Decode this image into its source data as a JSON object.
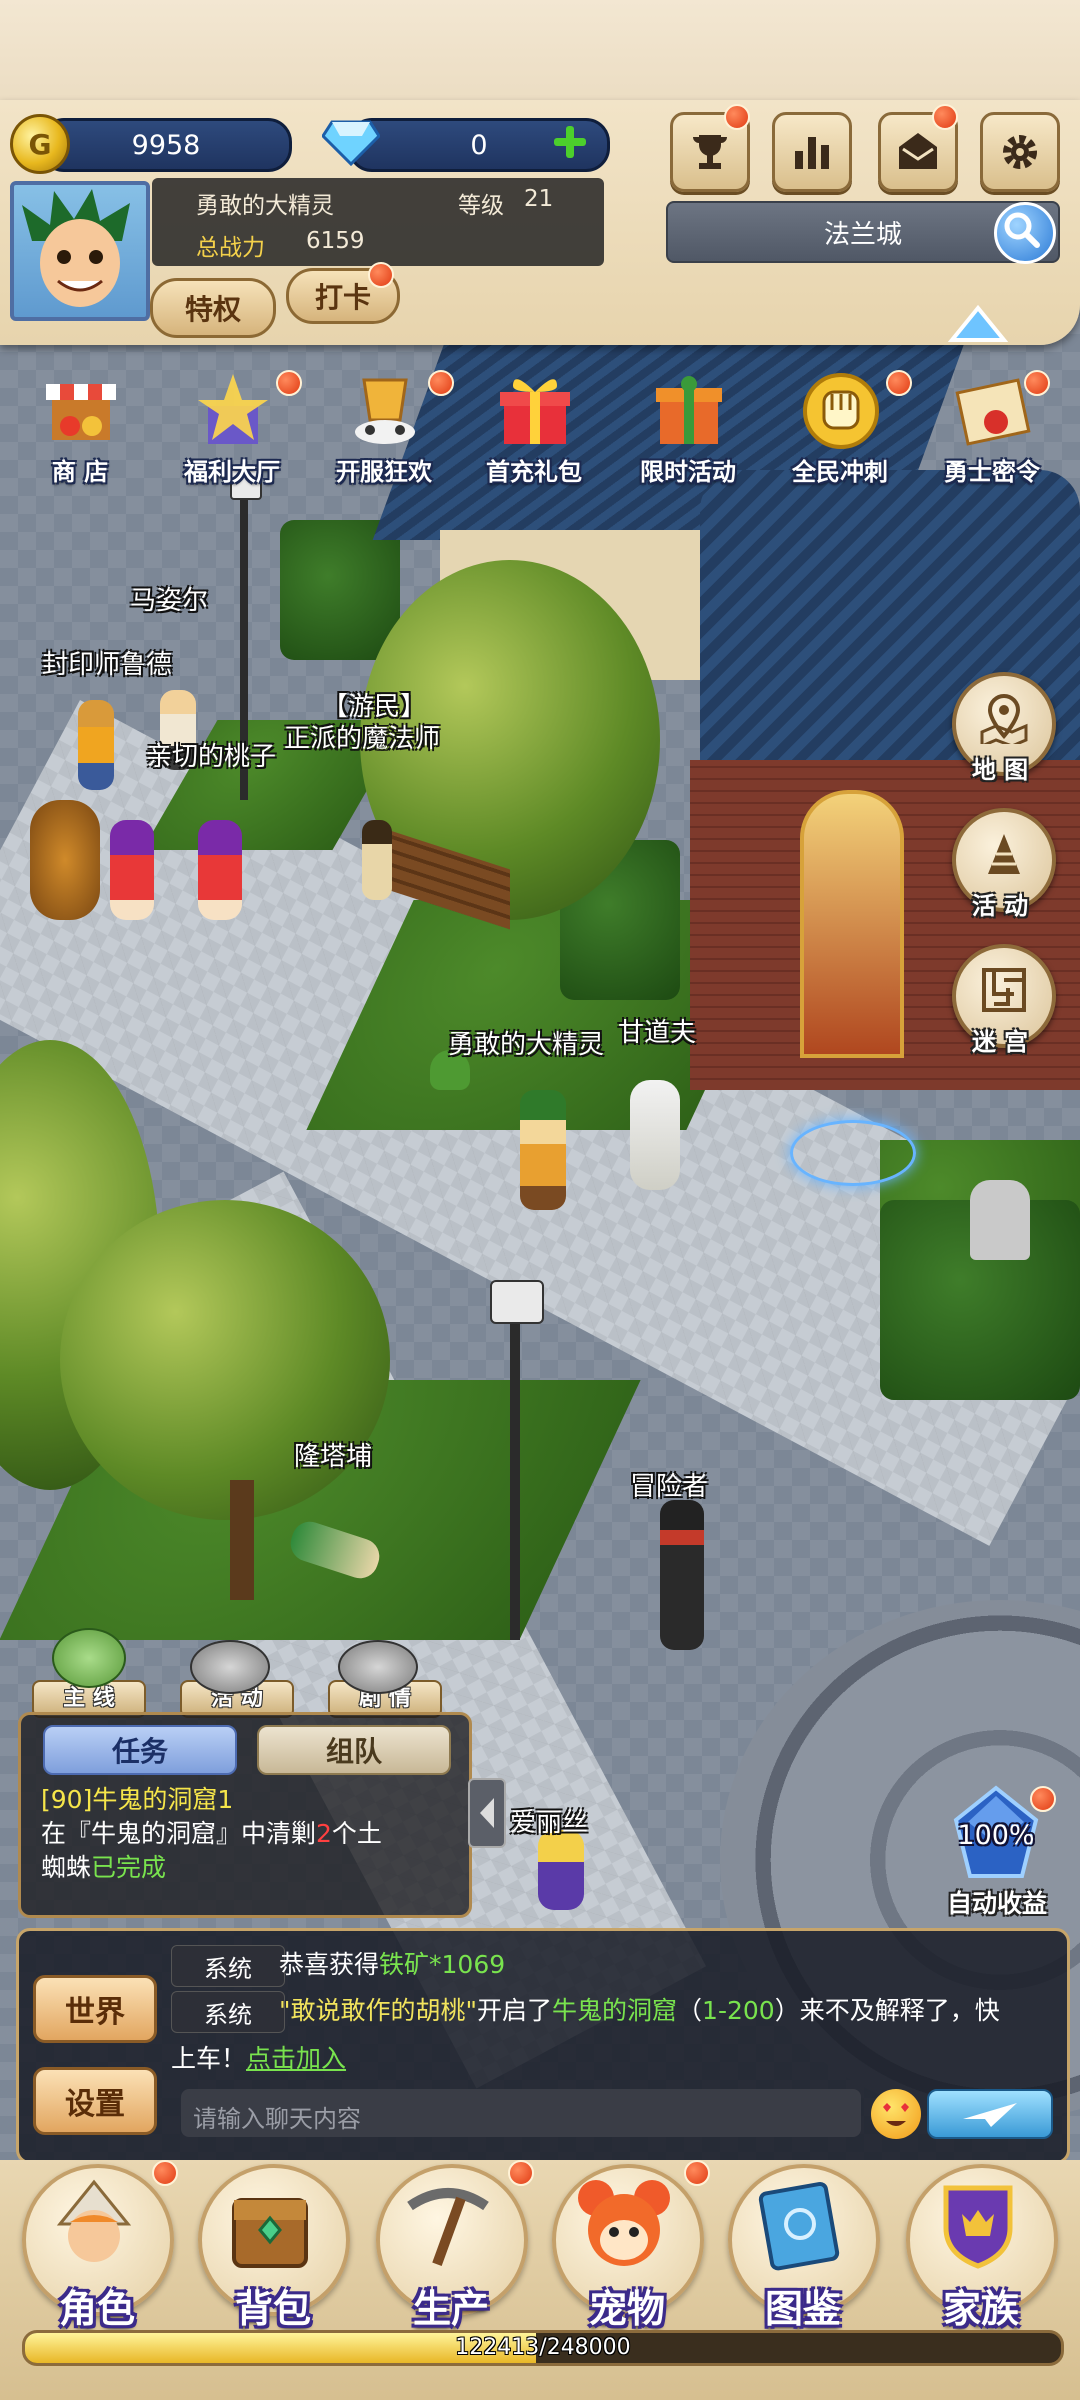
{
  "resources": {
    "gold": "9958",
    "gold_symbol": "G",
    "diamonds": "0"
  },
  "player": {
    "name": "勇敢的大精灵",
    "level_label": "等级",
    "level": "21",
    "power_label": "总战力",
    "power": "6159"
  },
  "buttons": {
    "privilege": "特权",
    "checkin": "打卡"
  },
  "location": "法兰城",
  "top_icons": [
    "trophy-icon",
    "stats-icon",
    "mail-icon",
    "gear-icon"
  ],
  "events": [
    {
      "label": "商 店",
      "icon": "shop-icon",
      "badge": false
    },
    {
      "label": "福利大厅",
      "icon": "welfare-icon",
      "badge": true
    },
    {
      "label": "开服狂欢",
      "icon": "carnival-icon",
      "badge": true
    },
    {
      "label": "首充礼包",
      "icon": "gift-icon",
      "badge": false
    },
    {
      "label": "限时活动",
      "icon": "limited-event-icon",
      "badge": false
    },
    {
      "label": "全民冲刺",
      "icon": "fist-icon",
      "badge": true
    },
    {
      "label": "勇士密令",
      "icon": "letter-icon",
      "badge": true
    }
  ],
  "npcs": [
    {
      "name": "马姿尔"
    },
    {
      "name": "封印师鲁德"
    },
    {
      "name": "亲切的桃子"
    },
    {
      "name": "【游民】"
    },
    {
      "name": "正派的魔法师"
    },
    {
      "name": "勇敢的大精灵"
    },
    {
      "name": "甘道夫"
    },
    {
      "name": "隆塔埔"
    },
    {
      "name": "冒险者"
    },
    {
      "name": "爱丽丝"
    }
  ],
  "side_buttons": [
    {
      "label": "地 图",
      "icon": "map-icon"
    },
    {
      "label": "活 动",
      "icon": "activity-icon"
    },
    {
      "label": "迷 宫",
      "icon": "maze-icon"
    }
  ],
  "auto_income": {
    "percent": "100%",
    "label": "自动收益"
  },
  "quest_tabs_mini": [
    "主 线",
    "活 动",
    "剧 情"
  ],
  "quest": {
    "tab_task": "任务",
    "tab_team": "组队",
    "title": "[90]牛鬼的洞窟1",
    "desc_pre": "在『牛鬼的洞窟』中清剿",
    "count": "2",
    "desc_post": "个土",
    "desc_line2": "蜘蛛",
    "status": "已完成"
  },
  "chat": {
    "world_btn": "世界",
    "settings_btn": "设置",
    "msg1": {
      "tag": "系统",
      "pre": "恭喜获得",
      "item": "铁矿*1069"
    },
    "msg2": {
      "tag": "系统",
      "player": "\"敢说敢作的胡桃\"",
      "mid": "开启了",
      "dungeon": "牛鬼的洞窟",
      "range_open": "（",
      "range": "1-200",
      "range_close": "）",
      "post": "来不及解释了，快",
      "line2": "上车！",
      "link": "点击加入"
    },
    "input_placeholder": "请输入聊天内容"
  },
  "nav": [
    {
      "label": "角色",
      "badge": true
    },
    {
      "label": "背包",
      "badge": false
    },
    {
      "label": "生产",
      "badge": true
    },
    {
      "label": "宠物",
      "badge": true
    },
    {
      "label": "图鉴",
      "badge": false
    },
    {
      "label": "家族",
      "badge": false
    }
  ],
  "xp": {
    "text": "122413/248000",
    "current": 122413,
    "max": 248000
  },
  "colors": {
    "hud_bg": "#eadbc0",
    "pill_bg": "#1f3460",
    "badge_red": "#e03a12",
    "accent_green": "#79e34e"
  }
}
